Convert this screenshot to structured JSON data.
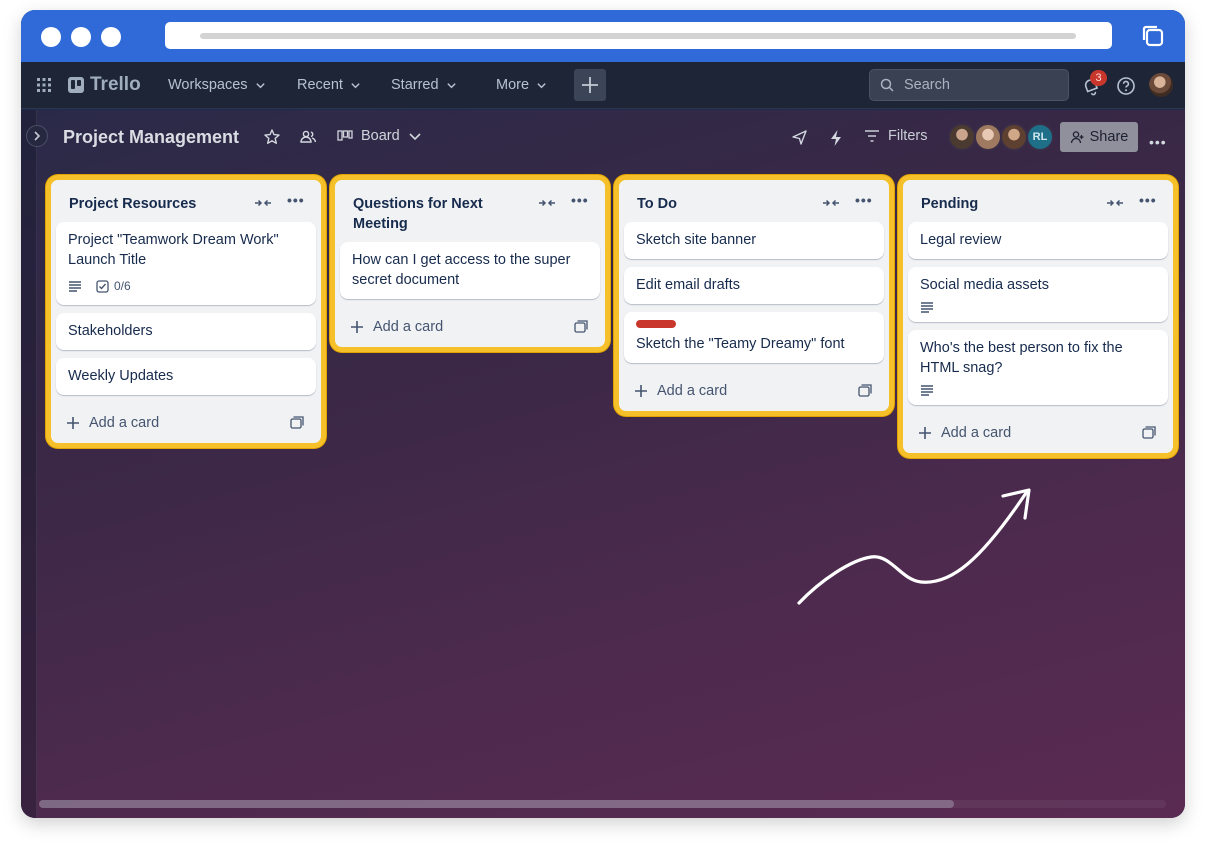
{
  "app": {
    "name": "Trello",
    "nav": [
      "Workspaces",
      "Recent",
      "Starred",
      "More"
    ],
    "search_placeholder": "Search",
    "notification_count": "3"
  },
  "board": {
    "title": "Project Management",
    "view_label": "Board",
    "filters_label": "Filters",
    "share_label": "Share",
    "member_initials": "RL"
  },
  "lists": [
    {
      "title": "Project Resources",
      "cards": [
        {
          "title": "Project \"Teamwork Dream Work\" Launch Title",
          "checklist": "0/6",
          "has_description": true
        },
        {
          "title": "Stakeholders"
        },
        {
          "title": "Weekly Updates"
        }
      ],
      "add_label": "Add a card"
    },
    {
      "title": "Questions for Next Meeting",
      "cards": [
        {
          "title": "How can I get access to the super secret document"
        }
      ],
      "add_label": "Add a card"
    },
    {
      "title": "To Do",
      "cards": [
        {
          "title": "Sketch site banner"
        },
        {
          "title": "Edit email drafts"
        },
        {
          "title": "Sketch the \"Teamy Dreamy\" font",
          "label_color": "#c9372c"
        }
      ],
      "add_label": "Add a card"
    },
    {
      "title": "Pending",
      "cards": [
        {
          "title": "Legal review"
        },
        {
          "title": "Social media assets",
          "has_description": true
        },
        {
          "title": "Who's the best person to fix the HTML snag?",
          "has_description": true
        }
      ],
      "add_label": "Add a card"
    }
  ],
  "colors": {
    "chrome_blue": "#2f6ad8",
    "highlight": "#f5c02a",
    "label_red": "#c9372c"
  }
}
